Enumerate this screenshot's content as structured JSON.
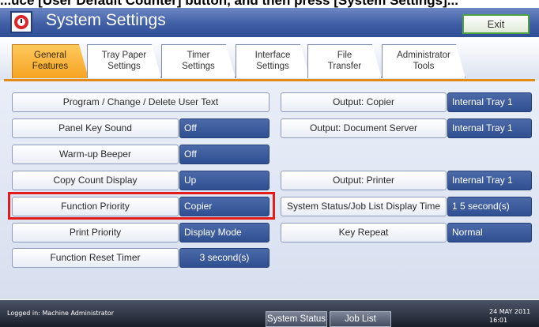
{
  "window": {
    "title": "System Settings",
    "exit_label": "Exit"
  },
  "cropped_caption": "...uce [User Default Counter] button, and then press [System Settings]...",
  "tabs": [
    {
      "line1": "General",
      "line2": "Features",
      "active": true
    },
    {
      "line1": "Tray Paper",
      "line2": "Settings",
      "active": false
    },
    {
      "line1": "Timer",
      "line2": "Settings",
      "active": false
    },
    {
      "line1": "Interface",
      "line2": "Settings",
      "active": false
    },
    {
      "line1": "File",
      "line2": "Transfer",
      "active": false
    },
    {
      "line1": "Administrator",
      "line2": "Tools",
      "active": false
    }
  ],
  "left_settings": [
    {
      "label": "Program / Change / Delete User Text",
      "value": null
    },
    {
      "label": "Panel Key Sound",
      "value": "Off"
    },
    {
      "label": "Warm-up Beeper",
      "value": "Off"
    },
    {
      "label": "Copy Count Display",
      "value": "Up"
    },
    {
      "label": "Function Priority",
      "value": "Copier",
      "highlighted": true
    },
    {
      "label": "Print Priority",
      "value": "Display Mode"
    },
    {
      "label": "Function Reset Timer",
      "value": "3  second(s)"
    }
  ],
  "right_settings": [
    {
      "label": "Output: Copier",
      "value": "Internal Tray 1"
    },
    {
      "label": "Output: Document Server",
      "value": "Internal Tray 1"
    },
    {
      "label": "Output: Printer",
      "value": "Internal Tray 1"
    },
    {
      "label": "System Status/Job List Display Time",
      "value": "1 5  second(s)"
    },
    {
      "label": "Key Repeat",
      "value": "Normal"
    }
  ],
  "status_bar": {
    "logged_in": "Logged in: Machine Administrator",
    "system_status_label": "System Status",
    "job_list_label": "Job List",
    "date": "24  MAY    2011",
    "time": "16:01"
  },
  "colors": {
    "accent_tab": "#f6a424",
    "value_blue": "#2f4f92",
    "highlight_red": "#e41b1b",
    "exit_border": "#4ea244"
  }
}
